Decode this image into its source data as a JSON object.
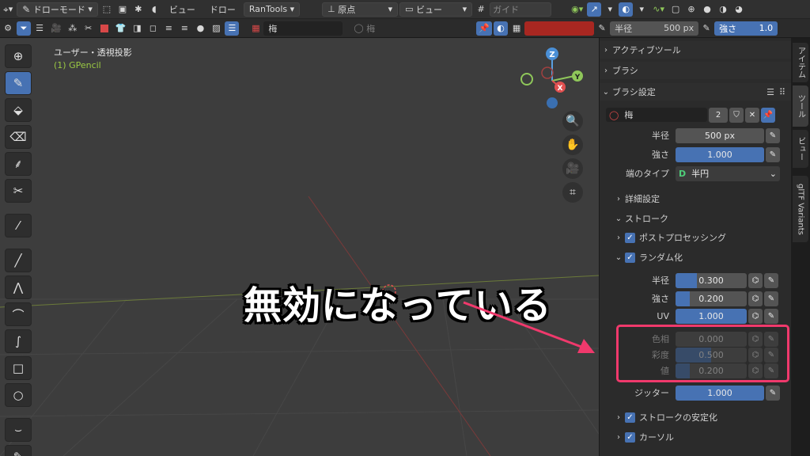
{
  "header1": {
    "mode_label": "ドローモード",
    "view_menu": "ビュー",
    "draw_menu": "ドロー",
    "addon_menu": "RanTools",
    "origin_label": "原点",
    "view_select": "ビュー",
    "guide_label": "ガイド"
  },
  "header2": {
    "brush_name": "梅",
    "material_name": "梅",
    "radius_label": "半径",
    "radius_value": "500 px",
    "strength_label": "強さ",
    "strength_value": "1.0",
    "color_swatch": "#a82721"
  },
  "viewport": {
    "title": "ユーザー・透視投影",
    "subtitle": "(1) GPencil",
    "overlay_text": "無効になっている",
    "gizmo": {
      "z": "Z",
      "y": "Y",
      "x": "X"
    }
  },
  "panel": {
    "active_tool": "アクティブツール",
    "brush": "ブラシ",
    "brush_settings": "ブラシ設定",
    "brush_slot_name": "梅",
    "brush_users": "2",
    "radius_label": "半径",
    "radius_value": "500 px",
    "strength_label": "強さ",
    "strength_value": "1.000",
    "cap_label": "端のタイプ",
    "cap_value": "半円",
    "advanced": "詳細設定",
    "stroke": "ストローク",
    "post_processing": "ポストプロセッシング",
    "randomize": "ランダム化",
    "rand_radius_label": "半径",
    "rand_radius_value": "0.300",
    "rand_strength_label": "強さ",
    "rand_strength_value": "0.200",
    "uv_label": "UV",
    "uv_value": "1.000",
    "hue_label": "色相",
    "hue_value": "0.000",
    "sat_label": "彩度",
    "sat_value": "0.500",
    "val_label": "値",
    "val_value": "0.200",
    "jitter_label": "ジッター",
    "jitter_value": "1.000",
    "stabilize": "ストロークの安定化",
    "cursor": "カーソル"
  },
  "tabs": [
    "アイテム",
    "ツール",
    "ビュー",
    "glTF Variants"
  ],
  "colors": {
    "accent": "#4772b3",
    "highlight": "#f0396c"
  }
}
